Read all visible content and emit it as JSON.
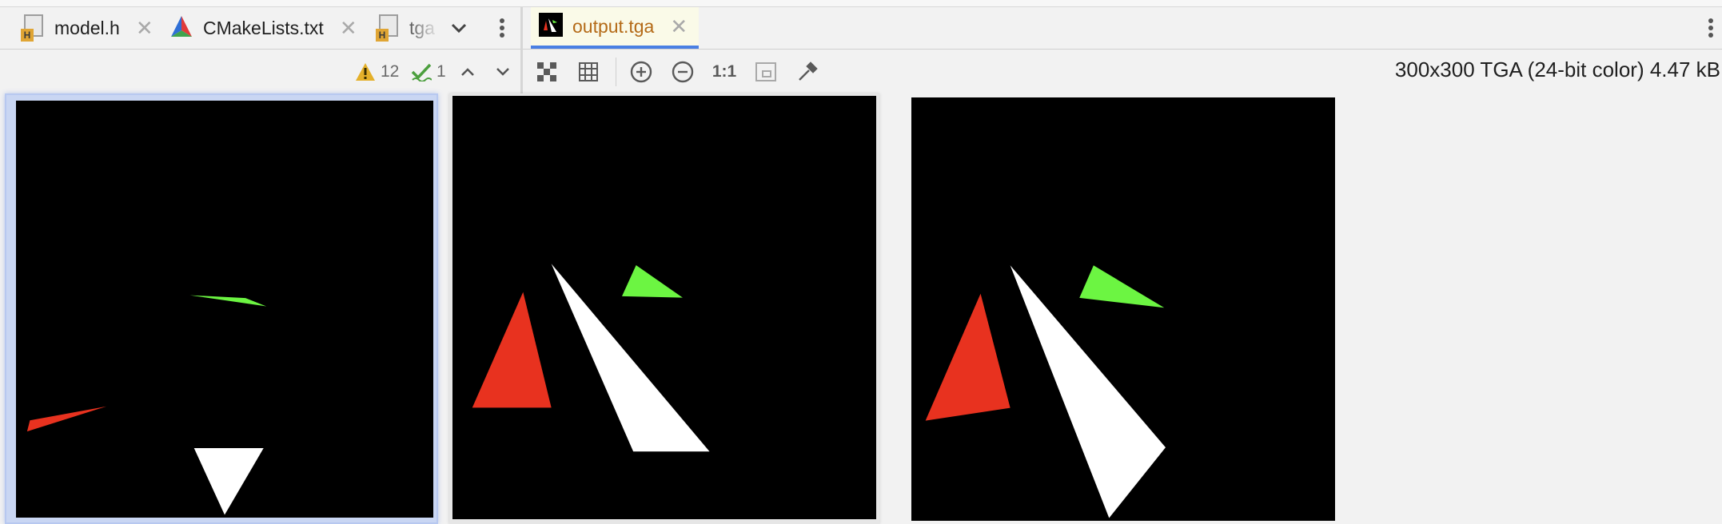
{
  "tabs_left": [
    {
      "label": "model.h",
      "icon": "header-file-icon"
    },
    {
      "label": "CMakeLists.txt",
      "icon": "cmake-icon"
    },
    {
      "label": "tga",
      "icon": "header-file-icon"
    }
  ],
  "tabs_right": [
    {
      "label": "output.tga",
      "icon": "tga-image-icon",
      "active": true
    }
  ],
  "file_icon_badge": "H",
  "close_glyph": "✕",
  "inspections": {
    "warnings": "12",
    "weak_warnings": "1"
  },
  "image_toolbar": {
    "actual_size_label": "1:1"
  },
  "image_info": "300x300 TGA (24-bit color) 4.47 kB",
  "colors": {
    "red": "#e8321f",
    "green": "#6cf542",
    "white": "#ffffff",
    "active_tab_label": "#b46a17",
    "accent": "#4a80e3"
  }
}
